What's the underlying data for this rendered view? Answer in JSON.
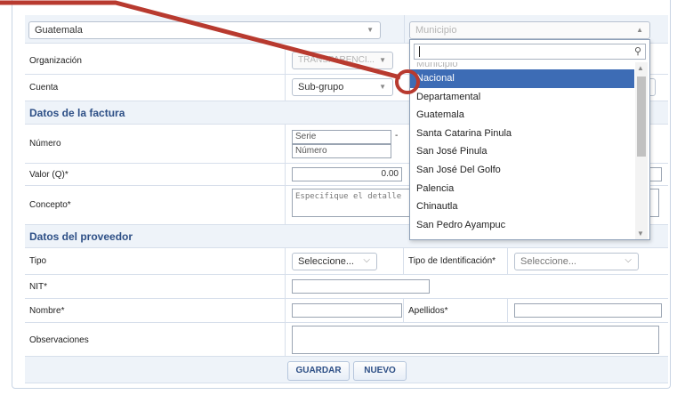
{
  "top": {
    "department_select": "Guatemala",
    "municipio_select": "Municipio"
  },
  "form": {
    "organizacion_label": "Organización",
    "organizacion_value": "TRANSPARENCI...",
    "cuenta_label": "Cuenta",
    "cuenta_value": "Sub-grupo",
    "factura_section": "Datos de la factura",
    "numero_label": "Número",
    "serie_placeholder": "Serie",
    "numero_placeholder": "Número",
    "serie_dash": "-",
    "valor_label": "Valor (Q)*",
    "valor_value": "0.00",
    "concepto_label": "Concepto*",
    "concepto_placeholder": "Especifique el detalle",
    "proveedor_section": "Datos del proveedor",
    "tipo_label": "Tipo",
    "tipo_value": "Seleccione...",
    "tipo_id_label": "Tipo de Identificación*",
    "tipo_id_value": "Seleccione...",
    "nit_label": "NIT*",
    "nombre_label": "Nombre*",
    "apellidos_label": "Apellidos*",
    "observaciones_label": "Observaciones",
    "guardar_button": "GUARDAR",
    "nuevo_button": "NUEVO"
  },
  "dropdown": {
    "placeholder": "Municipio",
    "items": [
      "Nacional",
      "Departamental",
      "Guatemala",
      "Santa Catarina Pinula",
      "San José Pinula",
      "San José Del Golfo",
      "Palencia",
      "Chinautla",
      "San Pedro Ayampuc"
    ],
    "selected_index": 0
  },
  "annotation": {
    "arrow_color": "#b83a2f"
  }
}
